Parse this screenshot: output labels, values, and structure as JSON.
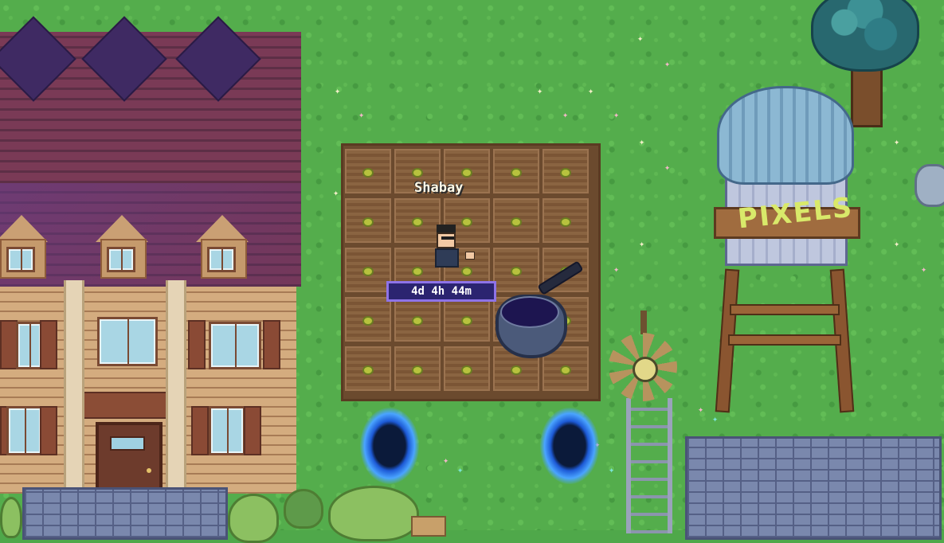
{
  "player": {
    "name": "Shabay",
    "timer": "4d 4h 44m"
  },
  "water_tower": {
    "label": "PIXELS"
  },
  "field": {
    "rows": 5,
    "cols": 5
  },
  "icons": {
    "player": "farmer-avatar",
    "pan": "frying-pan-icon",
    "portal": "teleport-portal-icon",
    "windmill": "windmill-icon",
    "tower": "water-tower-icon",
    "tree": "tree-icon",
    "house": "house-icon"
  },
  "colors": {
    "grass": "#54ad4c",
    "timer_bg": "#2b2470",
    "timer_border": "#8e73e8",
    "portal": "#4aa4ff"
  }
}
